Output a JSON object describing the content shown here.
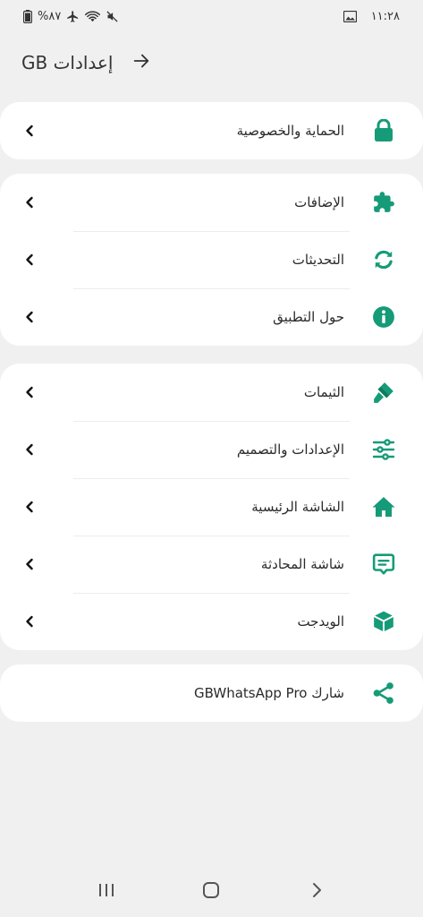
{
  "status_bar": {
    "time": "١١:٢٨",
    "battery": "%٨٧",
    "icons": [
      "gallery-icon",
      "battery-icon",
      "airplane-icon",
      "wifi-icon",
      "mute-icon"
    ]
  },
  "header": {
    "title": "إعدادات GB",
    "back_icon": "arrow-back-icon"
  },
  "accent_color": "#159b77",
  "groups": [
    {
      "items": [
        {
          "label": "الحماية والخصوصية",
          "icon": "lock-icon"
        }
      ]
    },
    {
      "items": [
        {
          "label": "الإضافات",
          "icon": "puzzle-icon"
        },
        {
          "label": "التحديثات",
          "icon": "sync-icon"
        },
        {
          "label": "حول التطبيق",
          "icon": "info-icon"
        }
      ]
    },
    {
      "items": [
        {
          "label": "الثيمات",
          "icon": "paint-icon"
        },
        {
          "label": "الإعدادات والتصميم",
          "icon": "sliders-icon"
        },
        {
          "label": "الشاشة الرئيسية",
          "icon": "home-icon"
        },
        {
          "label": "شاشة المحادثة",
          "icon": "chat-icon"
        },
        {
          "label": "الويدجت",
          "icon": "cube-icon"
        }
      ]
    },
    {
      "items": [
        {
          "label": "شارك GBWhatsApp Pro",
          "icon": "share-icon"
        }
      ]
    }
  ],
  "nav_bar": {
    "recents_icon": "recents-icon",
    "home_icon": "home-button-icon",
    "back_icon": "nav-back-icon"
  }
}
